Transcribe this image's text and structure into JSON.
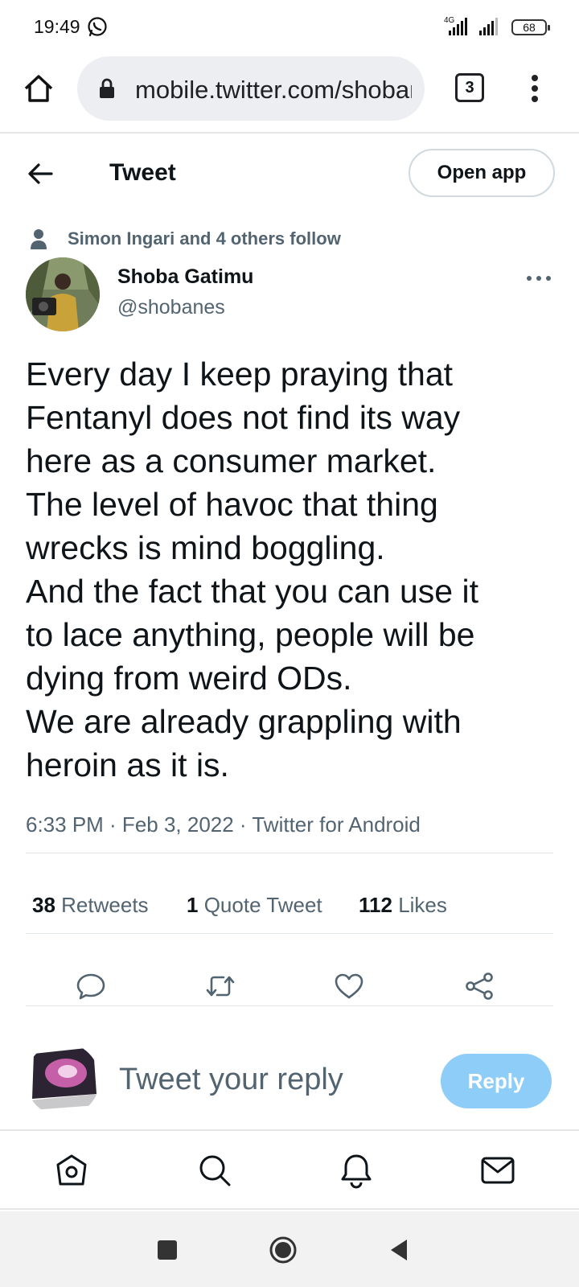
{
  "status_bar": {
    "time": "19:49",
    "network": "4G",
    "battery": "68"
  },
  "browser": {
    "url": "mobile.twitter.com/shobanes",
    "tab_count": "3"
  },
  "header": {
    "title": "Tweet",
    "open_app_label": "Open app"
  },
  "tweet": {
    "social_context": "Simon Ingari and 4 others follow",
    "author_name": "Shoba Gatimu",
    "author_handle": "@shobanes",
    "text_lines": [
      "Every day I keep praying that",
      "Fentanyl does not find its way",
      "here as a consumer market.",
      "The level of havoc that thing",
      "wrecks is mind boggling.",
      "And the fact that you can use it",
      "to lace anything, people will be",
      "dying from weird ODs.",
      "We are already grappling with",
      "heroin as it is."
    ],
    "meta": "6:33 PM · Feb 3, 2022 · Twitter for Android",
    "stats": {
      "retweets_count": "38",
      "retweets_label": "Retweets",
      "quotes_count": "1",
      "quotes_label": "Quote Tweet",
      "likes_count": "112",
      "likes_label": "Likes"
    }
  },
  "actions": [
    "reply-icon",
    "retweet-icon",
    "like-icon",
    "share-icon"
  ],
  "composer": {
    "placeholder": "Tweet your reply",
    "reply_label": "Reply"
  },
  "bottom_nav": [
    "home-icon",
    "search-icon",
    "notifications-icon",
    "messages-icon"
  ],
  "colors": {
    "primary_text": "#0f1419",
    "secondary_text": "#536471",
    "reply_button_disabled": "#8ecdf8",
    "divider": "#e1e6ea"
  }
}
